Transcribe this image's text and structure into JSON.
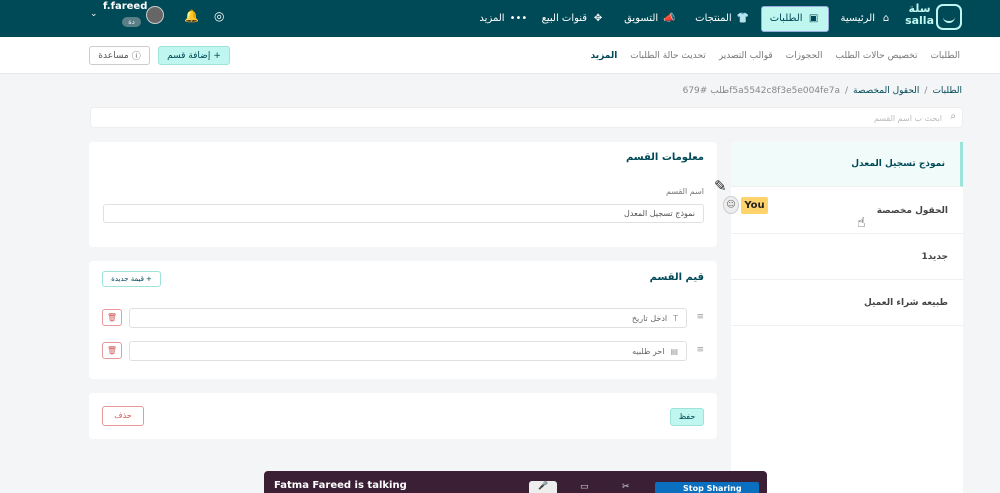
{
  "topbar": {
    "logo_text": "سلة\nsalla",
    "nav": [
      {
        "label": "الرئيسية",
        "icon": "home-icon",
        "glyph": "⌂",
        "active": false
      },
      {
        "label": "الطلبات",
        "icon": "box-icon",
        "glyph": "▣",
        "active": true
      },
      {
        "label": "المنتجات",
        "icon": "shirt-icon",
        "glyph": "👕",
        "active": false
      },
      {
        "label": "التسويق",
        "icon": "megaphone-icon",
        "glyph": "📣",
        "active": false
      },
      {
        "label": "قنوات البيع",
        "icon": "channels-icon",
        "glyph": "✥",
        "active": false
      },
      {
        "label": "المزيد",
        "icon": "more-icon",
        "glyph": "•••",
        "active": false
      }
    ],
    "user_name": "f.fareed",
    "user_badge": "دة"
  },
  "subnav": {
    "links": [
      "الطلبات",
      "تخصيص حالات الطلب",
      "الحجوزات",
      "قوالب التصدير",
      "تحديث حالة الطلبات",
      "المزيد"
    ],
    "add_section_label": "إضافة قسم",
    "help_label": "مساعدة"
  },
  "breadcrumb": {
    "items": [
      "الطلبات",
      "الحقول المخصصة",
      "طلب #679f5a5542c8f3e5e004fe7a"
    ]
  },
  "search": {
    "placeholder": "ابحث ب اسم القسم"
  },
  "side_list": {
    "items": [
      "نموذج تسجيل المعدل",
      "الحقول مخصصة",
      "جديد1",
      "طبيعه شراء العميل"
    ]
  },
  "section_info": {
    "title": "معلومات القسم",
    "name_label": "اسم القسم",
    "name_value": "نموذج تسجيل المعدل"
  },
  "section_values": {
    "title": "قيم القسم",
    "new_value_label": "قيمة جديدة",
    "rows": [
      {
        "placeholder": "ادخل تاريخ",
        "icon": "T"
      },
      {
        "placeholder": "احر طلبيه",
        "icon": "▤"
      }
    ]
  },
  "actions": {
    "save_label": "حفظ",
    "delete_label": "حذف"
  },
  "overlay": {
    "you_label": "You",
    "talking_text": "Fatma Fareed is talking",
    "stop_sharing_label": "Stop Sharing"
  }
}
